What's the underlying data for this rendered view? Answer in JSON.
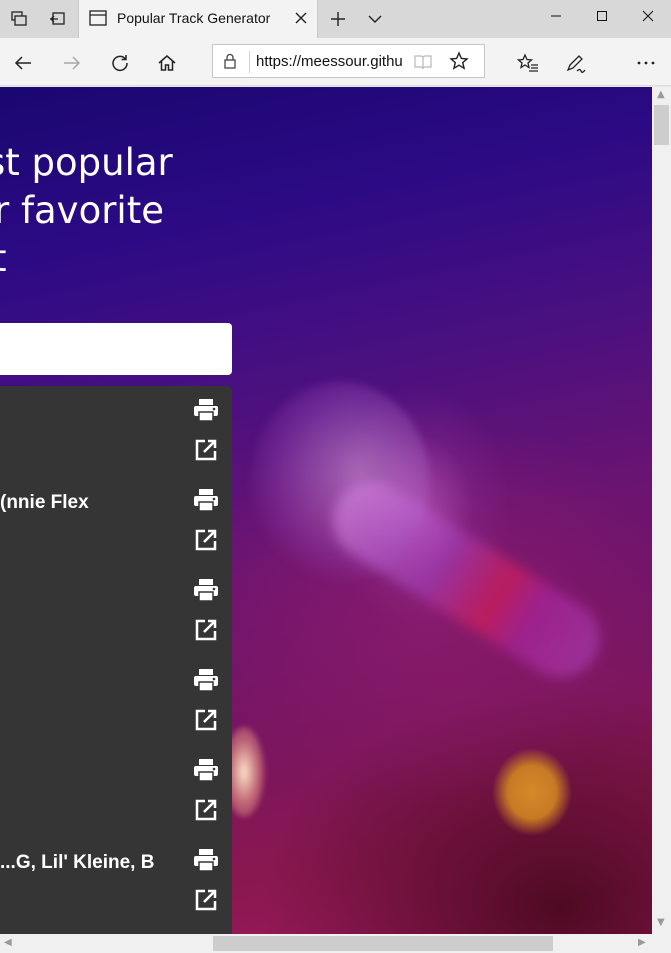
{
  "browser": {
    "tab_title": "Popular Track Generator",
    "url": "https://meessour.github.io",
    "colors": {
      "tabbar": "#d8d8d8",
      "toolbar": "#f3f3f3"
    }
  },
  "page": {
    "hero_lines": [
      "st popular",
      "r favorite",
      "t"
    ],
    "search_value": "",
    "tracks": [
      {
        "name": ""
      },
      {
        "name": "nnie Flex)"
      },
      {
        "name": ""
      },
      {
        "name": ""
      },
      {
        "name": ""
      },
      {
        "name": "G, Lil' Kleine, B..."
      }
    ],
    "icons": {
      "print": "print-icon",
      "open": "open-in-new-icon"
    },
    "colors": {
      "results_bg": "#353535",
      "hero_text": "#ffffff"
    }
  }
}
